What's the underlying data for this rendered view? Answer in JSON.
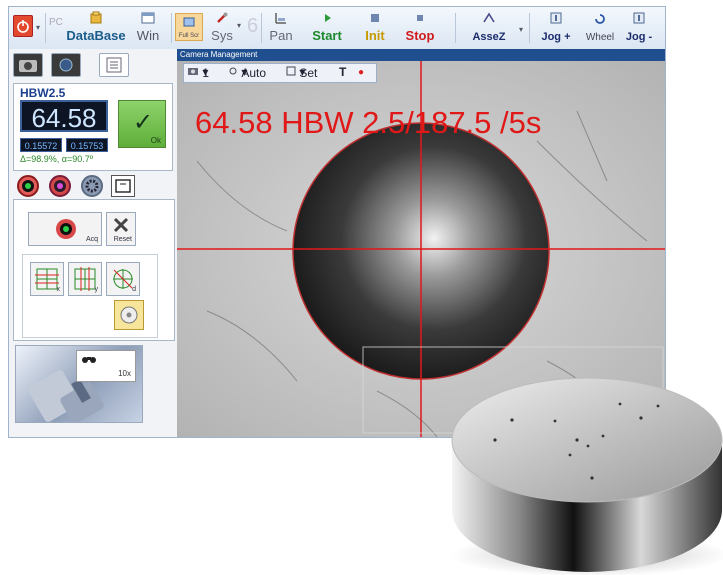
{
  "toolbar": {
    "items": [
      {
        "label": "DataBase"
      },
      {
        "label": "Win"
      },
      {
        "label": "Full Scr"
      },
      {
        "label": "Sys"
      },
      {
        "label": "Pan"
      },
      {
        "label": "Start"
      },
      {
        "label": "Init"
      },
      {
        "label": "Stop"
      },
      {
        "label": "AsseZ"
      },
      {
        "label": "Jog +"
      },
      {
        "label": "Wheel"
      },
      {
        "label": "Jog -"
      }
    ]
  },
  "measurement": {
    "scale_label": "HBW2.5",
    "value": "64.58",
    "d1": "0.15572",
    "d2": "0.15753",
    "delta_text": "Δ=98.9%, α=90.7º",
    "ok_label": "Ok"
  },
  "tools": {
    "acq_label": "Acq",
    "reset_label": "Reset",
    "x_label": "x",
    "y_label": "y",
    "d_label": "d"
  },
  "thumbnail": {
    "magnification": "10x"
  },
  "camera": {
    "title": "Camera Management",
    "cam_number": "1",
    "auto_label": "Auto",
    "set_label": "Set",
    "text_tool": "T",
    "overlay_text": "64.58 HBW 2.5/187.5 /5s"
  },
  "colors": {
    "accent": "#1c3f8e",
    "start": "#1e8a2e",
    "init": "#c69a00",
    "stop": "#d11b1b",
    "overlay": "#e01818",
    "ok": "#6cbf45"
  }
}
